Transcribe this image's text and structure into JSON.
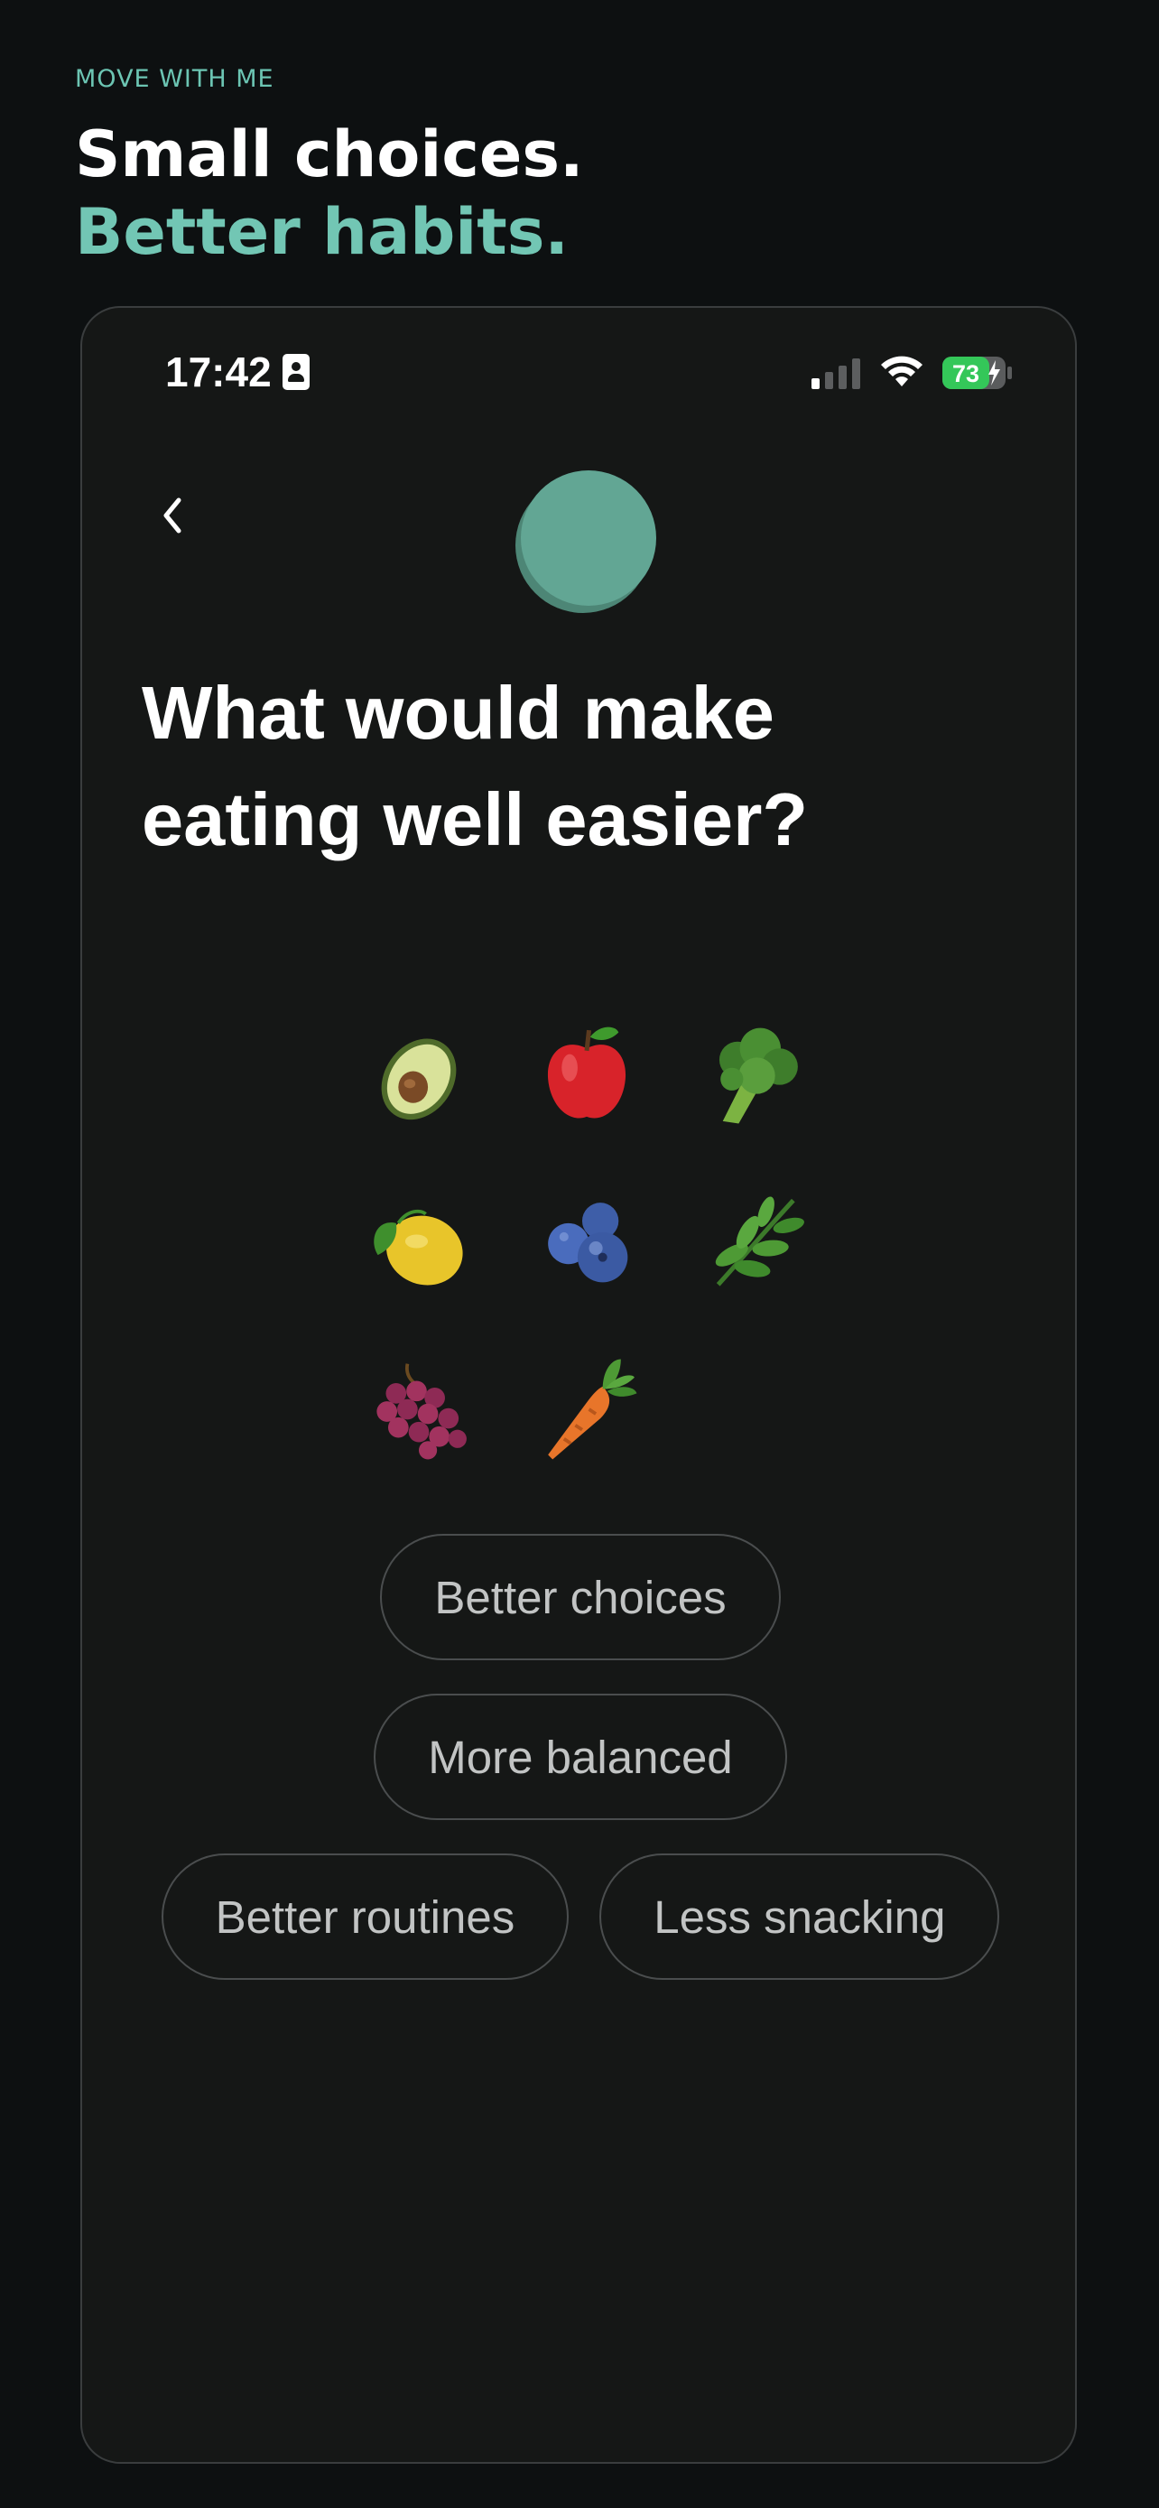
{
  "brand": {
    "eyebrow": "MOVE WITH ME",
    "headline_line1": "Small choices.",
    "headline_line2": "Better habits.",
    "accent_color": "#72c6b4"
  },
  "status_bar": {
    "time": "17:42",
    "battery_level": "73",
    "battery_color": "#34c759",
    "icons": [
      "contact-card-icon",
      "cellular-signal-icon",
      "wifi-icon",
      "battery-charging-icon"
    ]
  },
  "screen": {
    "back_icon": "chevron-left-icon",
    "avatar_color": "#62a694",
    "question": "What would make eating well easier?"
  },
  "foods": [
    "avocado",
    "apple",
    "broccoli",
    "lemon",
    "blueberries",
    "herb",
    "grapes",
    "carrot"
  ],
  "options": [
    {
      "label": "Better choices"
    },
    {
      "label": "More balanced"
    },
    {
      "label": "Better routines"
    },
    {
      "label": "Less snacking"
    }
  ]
}
